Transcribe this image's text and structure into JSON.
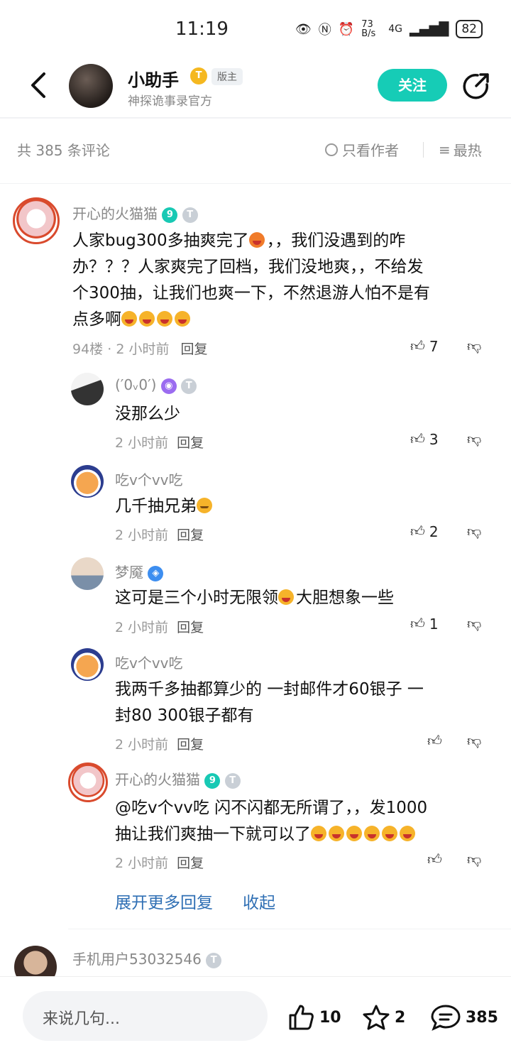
{
  "status_bar": {
    "time": "11:19",
    "net_speed": "73 B/s",
    "network": "4G",
    "battery": "82"
  },
  "header": {
    "title": "小助手",
    "title_badge": "T",
    "role_tag": "版主",
    "subtitle": "神探诡事录官方",
    "follow_label": "关注",
    "icons": [
      "back-arrow-icon",
      "share-icon"
    ]
  },
  "comment_bar": {
    "count_text": "共 385 条评论",
    "only_author": "只看作者",
    "sort_label": "最热"
  },
  "main_comment": {
    "user": "开心的火猫猫",
    "level_badges": [
      "9",
      "T"
    ],
    "text_lines": [
      "人家bug300多抽爽完了",
      "，，我们没遇到的咋",
      "办？？？人家爽完了回档，我们没地爽，，不给发",
      "个300抽，让我们也爽一下，不然退游人怕不是有",
      "点多啊"
    ],
    "floor": "94楼",
    "time": "2 小时前",
    "reply_label": "回复",
    "likes": "7"
  },
  "replies": [
    {
      "user": "(′0ᵥ0′)",
      "text": "没那么少",
      "time": "2 小时前",
      "reply_label": "回复",
      "likes": "3"
    },
    {
      "user": "吃v个vv吃",
      "text": "几千抽兄弟",
      "time": "2 小时前",
      "reply_label": "回复",
      "likes": "2"
    },
    {
      "user": "梦魇",
      "text_a": "这可是三个小时无限领",
      "text_b": "大胆想象一些",
      "time": "2 小时前",
      "reply_label": "回复",
      "likes": "1"
    },
    {
      "user": "吃v个vv吃",
      "text_lines": [
        "我两千多抽都算少的  一封邮件才60银子   一",
        "封80 300银子都有"
      ],
      "time": "2 小时前",
      "reply_label": "回复",
      "likes": ""
    },
    {
      "user": "开心的火猫猫",
      "text_lines": [
        "@吃v个vv吃  闪不闪都无所谓了，，发1000",
        "抽让我们爽抽一下就可以了"
      ],
      "time": "2 小时前",
      "reply_label": "回复",
      "likes": ""
    }
  ],
  "expand": {
    "more_label": "展开更多回复",
    "collapse_label": "收起"
  },
  "next_comment": {
    "user": "手机用户53032546"
  },
  "bottom_bar": {
    "placeholder": "来说几句...",
    "likes": "10",
    "stars": "2",
    "comments": "385"
  }
}
